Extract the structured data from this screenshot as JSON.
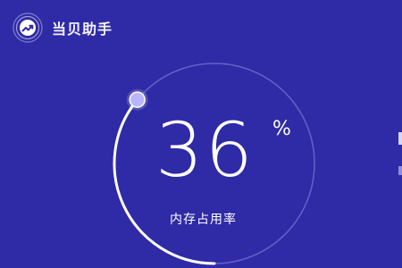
{
  "app": {
    "title": "当贝助手",
    "logo_icon": "trend-chart-icon"
  },
  "memory": {
    "value": "36",
    "unit": "%",
    "label": "内存占用率",
    "fraction": 0.36
  },
  "colors": {
    "background": "#2f2aa6",
    "ring_track": "#8f8be0",
    "ring_progress": "#ffffff",
    "knob": "#b9b6ff"
  }
}
